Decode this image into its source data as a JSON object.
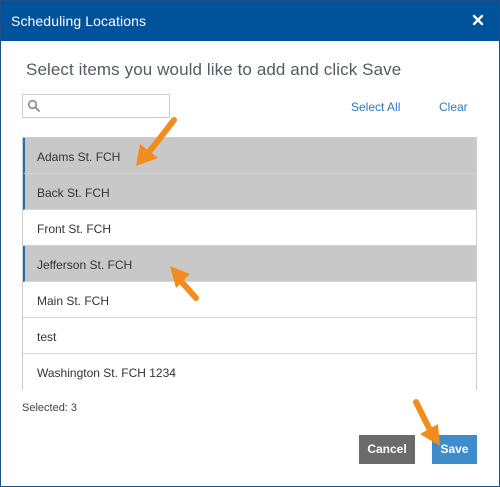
{
  "dialog": {
    "title": "Scheduling Locations",
    "close_symbol": "×",
    "instructions": "Select items you would like to add and click Save"
  },
  "search": {
    "value": "",
    "placeholder": "",
    "icon": "search-icon"
  },
  "actions": {
    "select_all": "Select All",
    "clear": "Clear"
  },
  "items": [
    {
      "label": "Adams St. FCH",
      "selected": true
    },
    {
      "label": "Back St. FCH",
      "selected": true
    },
    {
      "label": "Front St. FCH",
      "selected": false
    },
    {
      "label": "Jefferson St. FCH",
      "selected": true
    },
    {
      "label": "Main St. FCH",
      "selected": false
    },
    {
      "label": "test",
      "selected": false
    },
    {
      "label": "Washington St. FCH 1234",
      "selected": false
    }
  ],
  "footer": {
    "selected_count": "Selected: 3",
    "cancel_label": "Cancel",
    "save_label": "Save"
  },
  "colors": {
    "header": "#00529b",
    "selected_row": "#c8c8c8",
    "selected_accent": "#1f6fb8",
    "link": "#2a78c2",
    "cancel": "#6b6b6b",
    "save": "#3f8ccd",
    "annotation_arrow": "#f28c1e"
  }
}
